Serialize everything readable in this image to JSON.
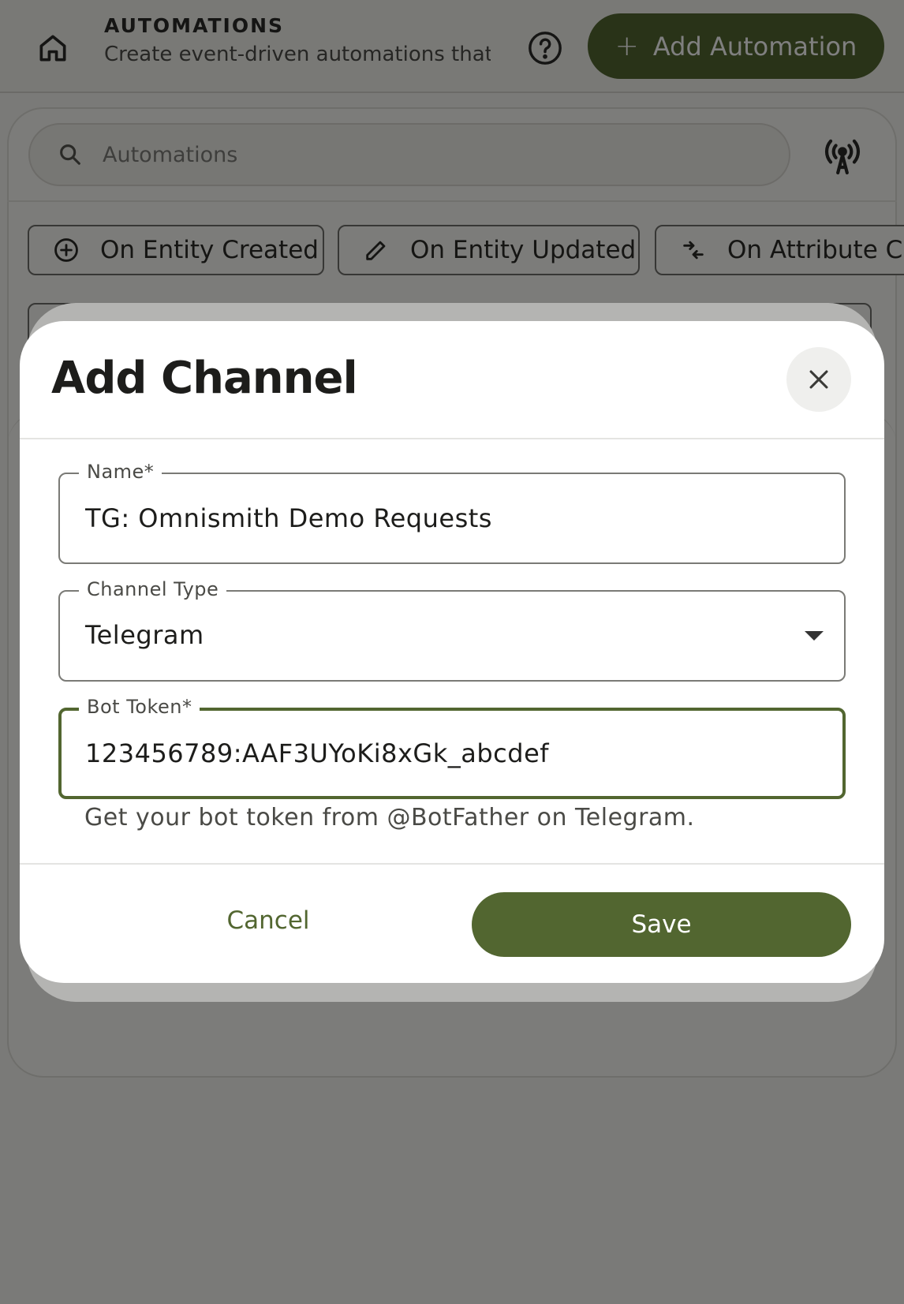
{
  "appbar": {
    "title": "AUTOMATIONS",
    "subtitle": "Create event-driven automations that trigger actions",
    "add_button_label": "Add Automation",
    "add_button_icon": "plus-icon"
  },
  "search": {
    "placeholder": "Automations"
  },
  "filter_chips": [
    {
      "label": "On Entity Created",
      "icon": "add-circle-icon"
    },
    {
      "label": "On Entity Updated",
      "icon": "pencil-icon"
    },
    {
      "label": "On Attribute Ch",
      "icon": "swap-arrows-icon"
    }
  ],
  "dialog": {
    "title": "Add Channel",
    "name_field": {
      "label": "Name*",
      "value": "TG: Omnismith Demo Requests"
    },
    "type_field": {
      "label": "Channel Type",
      "value": "Telegram"
    },
    "token_field": {
      "label": "Bot Token*",
      "value": "123456789:AAF3UYoKi8xGk_abcdef"
    },
    "helper_text": "Get your bot token from @BotFather on Telegram.",
    "cancel_label": "Cancel",
    "save_label": "Save"
  },
  "colors": {
    "primary": "#526630",
    "scrim": "rgba(0,0,0,0.5)"
  }
}
